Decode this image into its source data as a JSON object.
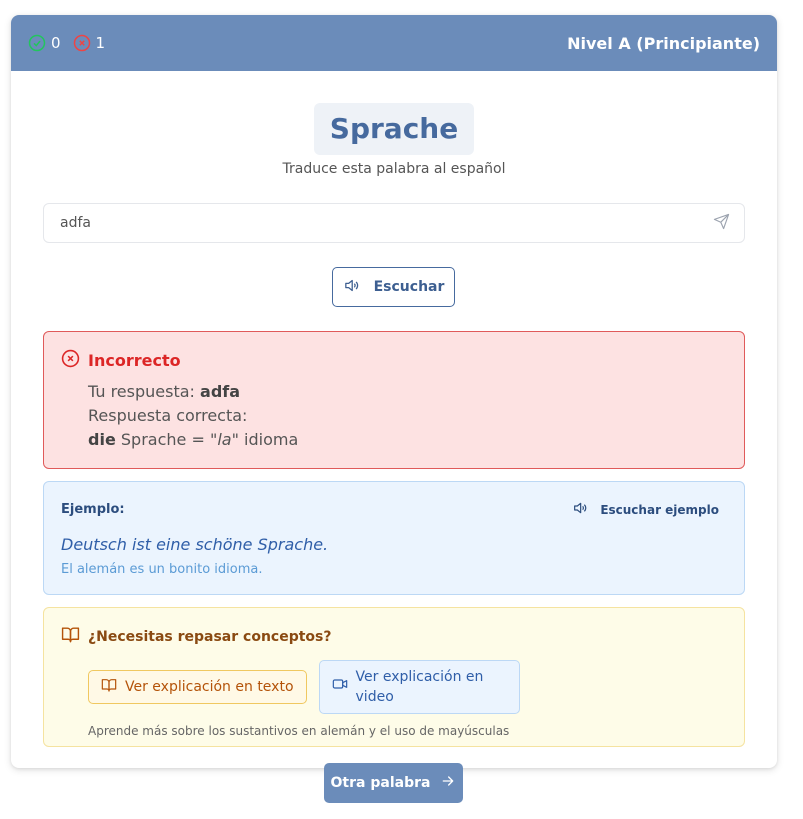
{
  "header": {
    "correct_count": "0",
    "wrong_count": "1",
    "level": "Nivel A (Principiante)",
    "colors": {
      "bar": "#6b8cba",
      "correct": "#22c55e",
      "wrong": "#ef4444"
    },
    "icons": {
      "correct": "check-circle-icon",
      "wrong": "x-circle-icon"
    }
  },
  "quiz": {
    "word": "Sprache",
    "instruction": "Traduce esta palabra al español"
  },
  "answer_input": {
    "value": "adfa",
    "placeholder": "",
    "icon": "send-icon"
  },
  "listen_button": {
    "label": "Escuchar",
    "icon": "speaker-icon"
  },
  "feedback": {
    "title": "Incorrecto",
    "your_answer_label": "Tu respuesta:",
    "your_answer": "adfa",
    "correct_label": "Respuesta correcta:",
    "article": "die",
    "noun": "Sprache =",
    "es_article": "\"la\"",
    "es_word": "idioma",
    "icon": "x-circle-icon"
  },
  "example": {
    "label": "Ejemplo:",
    "listen_label": "Escuchar ejemplo",
    "sentence_de": "Deutsch ist eine schöne Sprache.",
    "sentence_es": "El alemán es un bonito idioma."
  },
  "concepts": {
    "title": "¿Necesitas repasar conceptos?",
    "text_button": "Ver explicación en texto",
    "video_button": "Ver explicación en video",
    "note": "Aprende más sobre los sustantivos en alemán y el uso de mayúsculas"
  },
  "next_button": {
    "label": "Otra palabra",
    "icon": "arrow-right-icon"
  }
}
